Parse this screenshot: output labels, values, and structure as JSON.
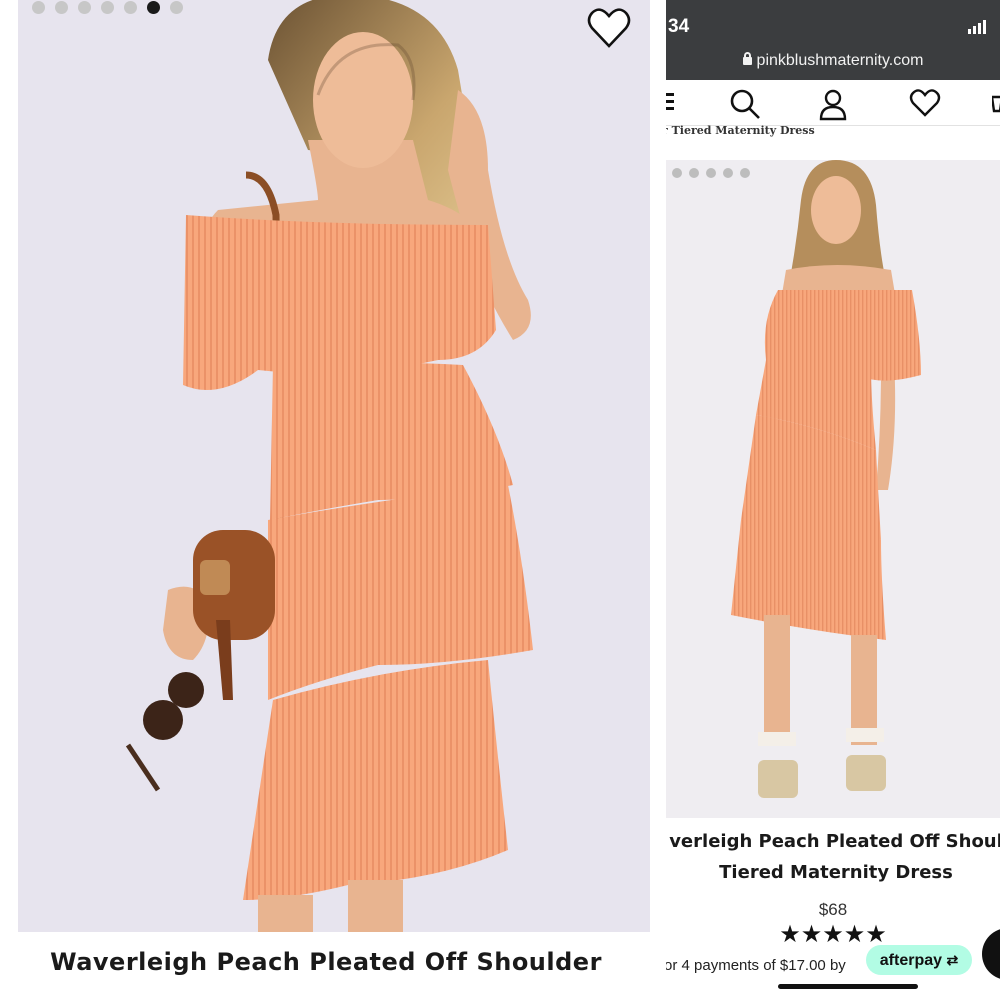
{
  "left": {
    "carousel": {
      "count": 7,
      "active_index": 5
    },
    "title": "Waverleigh Peach Pleated Off Shoulder"
  },
  "right": {
    "status": {
      "time": "34"
    },
    "url": "pinkblushmaternity.com",
    "breadcrumb": "r Tiered Maternity Dress",
    "carousel": {
      "count": 5,
      "active_index": -1
    },
    "title_line1": "verleigh Peach Pleated Off Shoul",
    "title_line2": "Tiered Maternity Dress",
    "price": "$68",
    "rating": {
      "stars": 5,
      "display": "★★★★★"
    },
    "afterpay": {
      "text": "or 4 payments of $17.00 by",
      "badge": "afterpay"
    }
  },
  "colors": {
    "dress": "#f8a77c",
    "photo_bg": "#e7e4ee",
    "status_bar": "#3b3d3f",
    "afterpay_mint": "#b2fce4"
  },
  "icons": [
    "heart-icon",
    "menu-icon",
    "search-icon",
    "account-icon",
    "wishlist-heart-icon",
    "cart-icon",
    "lock-icon",
    "signal-icon"
  ]
}
